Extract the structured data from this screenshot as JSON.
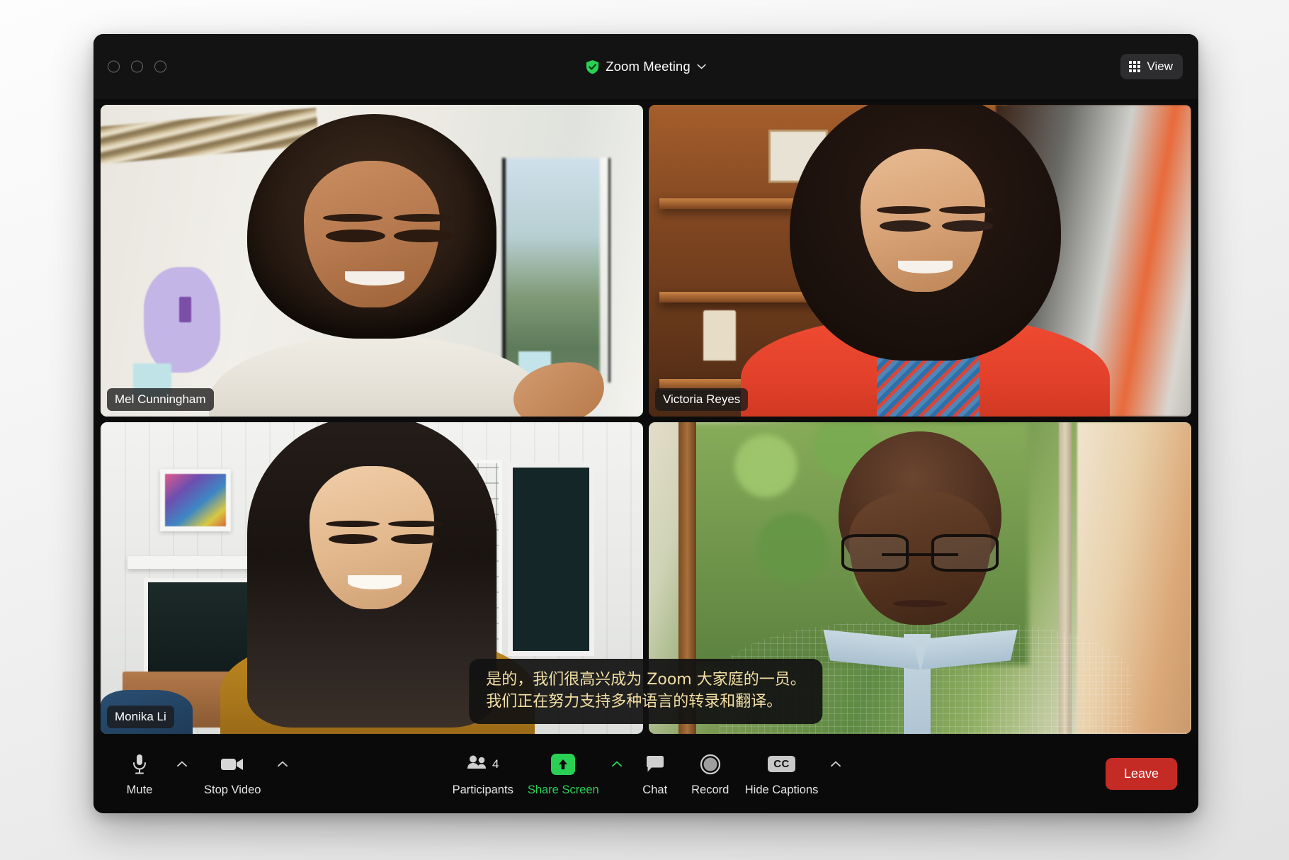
{
  "window": {
    "traffic_lights": [
      "close",
      "minimize",
      "zoom"
    ],
    "title": "Zoom Meeting",
    "shield_icon": "verified-shield-icon",
    "title_chevron_icon": "chevron-down-icon",
    "view_button": {
      "label": "View",
      "icon": "grid-icon"
    }
  },
  "grid": {
    "tiles": [
      {
        "name": "Mel Cunningham",
        "active_speaker": true,
        "position": "top-left",
        "scene": "bright white room with window and childs artwork"
      },
      {
        "name": "Victoria Reyes",
        "active_speaker": false,
        "position": "top-right",
        "scene": "wooden bookcase, red top, patterned scarf"
      },
      {
        "name": "Monika Li",
        "active_speaker": false,
        "position": "bottom-left",
        "scene": "white paneled living room with fireplace"
      },
      {
        "name": "",
        "active_speaker": false,
        "position": "bottom-right",
        "scene": "man with glasses by a window with green trees"
      }
    ]
  },
  "captions": {
    "line1": "是的，我们很高兴成为 Zoom 大家庭的一员。",
    "line2": "我们正在努力支持多种语言的转录和翻译。",
    "text_color": "#f3dfa4",
    "background_color": "#121212"
  },
  "toolbar": {
    "mute": {
      "label": "Mute",
      "icon": "microphone-icon",
      "caret": "chevron-up-icon"
    },
    "stop_video": {
      "label": "Stop Video",
      "icon": "video-camera-icon",
      "caret": "chevron-up-icon"
    },
    "participants": {
      "label": "Participants",
      "icon": "people-icon",
      "count": "4"
    },
    "share_screen": {
      "label": "Share Screen",
      "icon": "share-arrow-up-icon",
      "caret": "chevron-up-icon",
      "color": "#2ad053"
    },
    "chat": {
      "label": "Chat",
      "icon": "speech-bubble-icon"
    },
    "record": {
      "label": "Record",
      "icon": "record-circle-icon"
    },
    "captions": {
      "label": "Hide Captions",
      "icon": "cc-icon",
      "badge": "CC",
      "caret": "chevron-up-icon"
    },
    "leave": {
      "label": "Leave",
      "color": "#c52b25"
    }
  },
  "colors": {
    "active_speaker_border": "#2ad053",
    "accent_green": "#2ad053",
    "window_background": "#0c0c0c",
    "toolbar_background": "#0a0a0a",
    "leave_red": "#c52b25"
  }
}
